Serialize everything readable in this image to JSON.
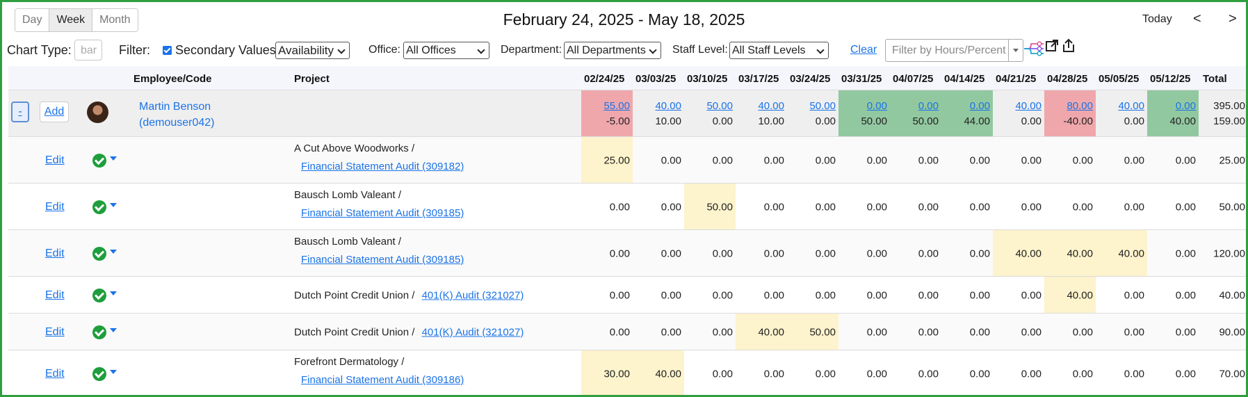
{
  "toolbar": {
    "views": [
      "Day",
      "Week",
      "Month"
    ],
    "active_view": "Week",
    "date_range": "February 24, 2025 - May 18, 2025",
    "today_label": "Today",
    "prev_label": "<",
    "next_label": ">"
  },
  "filters": {
    "chart_type_label": "Chart Type:",
    "chart_type_placeholder": "bar",
    "filter_label": "Filter:",
    "secondary_values_label": "Secondary Values",
    "secondary_values_checked": true,
    "secondary_select": "Availability",
    "office_label": "Office:",
    "office_value": "All Offices",
    "department_label": "Department:",
    "department_value": "All Departments",
    "staff_level_label": "Staff Level:",
    "staff_level_value": "All Staff Levels",
    "clear_label": "Clear",
    "hours_filter_placeholder": "Filter by Hours/Percent"
  },
  "table": {
    "headers": {
      "employee": "Employee/Code",
      "project": "Project",
      "weeks": [
        "02/24/25",
        "03/03/25",
        "03/10/25",
        "03/17/25",
        "03/24/25",
        "03/31/25",
        "04/07/25",
        "04/14/25",
        "04/21/25",
        "04/28/25",
        "05/05/25",
        "05/12/25"
      ],
      "total": "Total"
    },
    "employee": {
      "collapse_label": "-",
      "add_label": "Add",
      "name": "Martin Benson",
      "code": "(demouser042)",
      "hours": [
        "55.00",
        "40.00",
        "50.00",
        "40.00",
        "50.00",
        "0.00",
        "0.00",
        "0.00",
        "40.00",
        "80.00",
        "40.00",
        "0.00"
      ],
      "availability": [
        "-5.00",
        "10.00",
        "0.00",
        "10.00",
        "0.00",
        "50.00",
        "50.00",
        "44.00",
        "0.00",
        "-40.00",
        "0.00",
        "40.00"
      ],
      "status": [
        "red",
        "",
        "",
        "",
        "",
        "green",
        "green",
        "green",
        "",
        "red",
        "",
        "green"
      ],
      "total_hours": "395.00",
      "total_availability": "159.00"
    },
    "edit_label": "Edit",
    "rows": [
      {
        "client": "A Cut Above Woodworks /",
        "project": "Financial Statement Audit (309182)",
        "inline": false,
        "values": [
          "25.00",
          "0.00",
          "0.00",
          "0.00",
          "0.00",
          "0.00",
          "0.00",
          "0.00",
          "0.00",
          "0.00",
          "0.00",
          "0.00"
        ],
        "highlight": [
          true,
          false,
          false,
          false,
          false,
          false,
          false,
          false,
          false,
          false,
          false,
          false
        ],
        "total": "25.00"
      },
      {
        "client": "Bausch Lomb Valeant /",
        "project": "Financial Statement Audit (309185)",
        "inline": false,
        "values": [
          "0.00",
          "0.00",
          "50.00",
          "0.00",
          "0.00",
          "0.00",
          "0.00",
          "0.00",
          "0.00",
          "0.00",
          "0.00",
          "0.00"
        ],
        "highlight": [
          false,
          false,
          true,
          false,
          false,
          false,
          false,
          false,
          false,
          false,
          false,
          false
        ],
        "total": "50.00"
      },
      {
        "client": "Bausch Lomb Valeant /",
        "project": "Financial Statement Audit (309185)",
        "inline": false,
        "values": [
          "0.00",
          "0.00",
          "0.00",
          "0.00",
          "0.00",
          "0.00",
          "0.00",
          "0.00",
          "40.00",
          "40.00",
          "40.00",
          "0.00"
        ],
        "highlight": [
          false,
          false,
          false,
          false,
          false,
          false,
          false,
          false,
          true,
          true,
          true,
          false
        ],
        "total": "120.00"
      },
      {
        "client": "Dutch Point Credit Union /",
        "project": "401(K) Audit (321027)",
        "inline": true,
        "values": [
          "0.00",
          "0.00",
          "0.00",
          "0.00",
          "0.00",
          "0.00",
          "0.00",
          "0.00",
          "0.00",
          "40.00",
          "0.00",
          "0.00"
        ],
        "highlight": [
          false,
          false,
          false,
          false,
          false,
          false,
          false,
          false,
          false,
          true,
          false,
          false
        ],
        "total": "40.00"
      },
      {
        "client": "Dutch Point Credit Union /",
        "project": "401(K) Audit (321027)",
        "inline": true,
        "values": [
          "0.00",
          "0.00",
          "0.00",
          "40.00",
          "50.00",
          "0.00",
          "0.00",
          "0.00",
          "0.00",
          "0.00",
          "0.00",
          "0.00"
        ],
        "highlight": [
          false,
          false,
          false,
          true,
          true,
          false,
          false,
          false,
          false,
          false,
          false,
          false
        ],
        "total": "90.00"
      },
      {
        "client": "Forefront Dermatology /",
        "project": "Financial Statement Audit (309186)",
        "inline": false,
        "values": [
          "30.00",
          "40.00",
          "0.00",
          "0.00",
          "0.00",
          "0.00",
          "0.00",
          "0.00",
          "0.00",
          "0.00",
          "0.00",
          "0.00"
        ],
        "highlight": [
          true,
          true,
          false,
          false,
          false,
          false,
          false,
          false,
          false,
          false,
          false,
          false
        ],
        "total": "70.00"
      }
    ]
  },
  "icons": {
    "filter_lines": "filter-lines-icon",
    "expand": "expand-icon",
    "share": "share-icon",
    "check": "check-circle-icon"
  },
  "colors": {
    "frame": "#2e9e3e",
    "link": "#1a73e8",
    "over_allocated": "#efa7ac",
    "available": "#92c8a0",
    "allocated": "#fdf3cc"
  }
}
